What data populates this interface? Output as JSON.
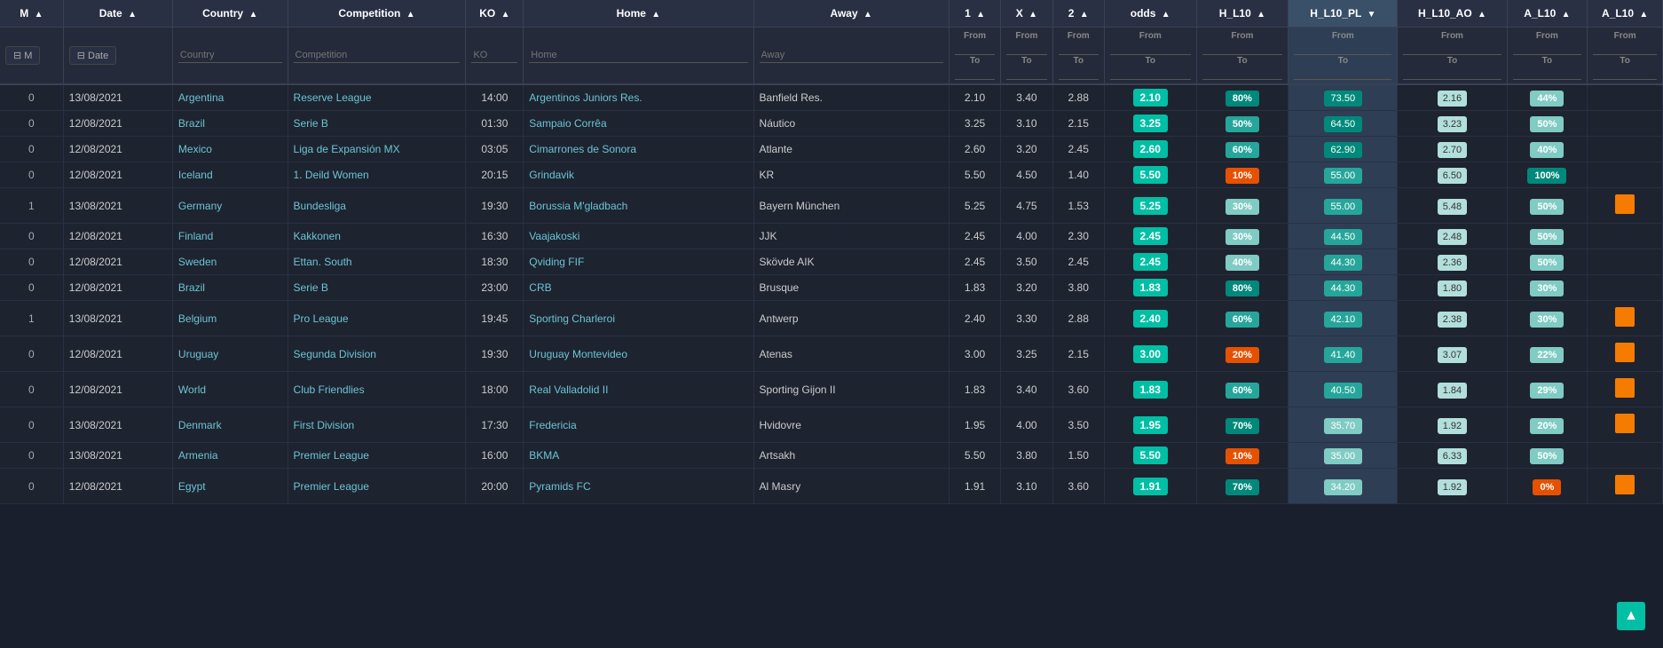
{
  "columns": {
    "m": "M",
    "date": "Date",
    "country": "Country",
    "competition": "Competition",
    "ko": "KO",
    "home": "Home",
    "away": "Away",
    "one": "1",
    "x": "X",
    "two": "2",
    "odds": "odds",
    "h_l10": "H_L10",
    "h_l10_pl": "H_L10_PL",
    "h_l10_ao": "H_L10_AO",
    "a_l10": "A_L10",
    "a_l10_last": "A_L10"
  },
  "filter_row": {
    "m_label": "M",
    "date_label": "Date",
    "country_label": "Country",
    "competition_label": "Competition",
    "ko_label": "KO",
    "home_label": "Home",
    "away_label": "Away",
    "one_label": "1",
    "x_label": "X",
    "two_label": "2",
    "from_label": "From",
    "to_label": "To"
  },
  "rows": [
    {
      "m": "0",
      "date": "13/08/2021",
      "country": "Argentina",
      "competition": "Reserve League",
      "ko": "14:00",
      "home": "Argentinos Juniors Res.",
      "away": "Banfield Res.",
      "one": "2.10",
      "x": "3.40",
      "two": "2.88",
      "odds": "2.10",
      "odds_color": "teal",
      "hl10_pct": "80%",
      "hl10_color": "teal-dark",
      "hl10pl": "73.50",
      "hl10pl_color": "teal-med",
      "hl10ao": "2.16",
      "hl10ao_color": "teal-light",
      "al10_pct": "44%",
      "al10_color": "teal-light",
      "al10_last": ""
    },
    {
      "m": "0",
      "date": "12/08/2021",
      "country": "Brazil",
      "competition": "Serie B",
      "ko": "01:30",
      "home": "Sampaio Corrêa",
      "away": "Náutico",
      "one": "3.25",
      "x": "3.10",
      "two": "2.15",
      "odds": "3.25",
      "odds_color": "teal",
      "hl10_pct": "50%",
      "hl10_color": "teal-med",
      "hl10pl": "64.50",
      "hl10pl_color": "teal-med",
      "hl10ao": "3.23",
      "hl10ao_color": "teal-light",
      "al10_pct": "50%",
      "al10_color": "teal-light",
      "al10_last": ""
    },
    {
      "m": "0",
      "date": "12/08/2021",
      "country": "Mexico",
      "competition": "Liga de Expansión MX",
      "ko": "03:05",
      "home": "Cimarrones de Sonora",
      "away": "Atlante",
      "one": "2.60",
      "x": "3.20",
      "two": "2.45",
      "odds": "2.60",
      "odds_color": "teal",
      "hl10_pct": "60%",
      "hl10_color": "teal-med",
      "hl10pl": "62.90",
      "hl10pl_color": "teal-med",
      "hl10ao": "2.70",
      "hl10ao_color": "teal-light",
      "al10_pct": "40%",
      "al10_color": "teal-light",
      "al10_last": ""
    },
    {
      "m": "0",
      "date": "12/08/2021",
      "country": "Iceland",
      "competition": "1. Deild Women",
      "ko": "20:15",
      "home": "Grindavik",
      "away": "KR",
      "one": "5.50",
      "x": "4.50",
      "two": "1.40",
      "odds": "5.50",
      "odds_color": "teal",
      "hl10_pct": "10%",
      "hl10_color": "orange",
      "hl10pl": "55.00",
      "hl10pl_color": "teal-med",
      "hl10ao": "6.50",
      "hl10ao_color": "teal-dark",
      "al10_pct": "100%",
      "al10_color": "teal-dark",
      "al10_last": ""
    },
    {
      "m": "1",
      "date": "13/08/2021",
      "country": "Germany",
      "competition": "Bundesliga",
      "ko": "19:30",
      "home": "Borussia M'gladbach",
      "away": "Bayern München",
      "one": "5.25",
      "x": "4.75",
      "two": "1.53",
      "odds": "5.25",
      "odds_color": "teal",
      "hl10_pct": "30%",
      "hl10_color": "teal-light",
      "hl10pl": "55.00",
      "hl10pl_color": "teal-med",
      "hl10ao": "5.48",
      "hl10ao_color": "teal-light",
      "al10_pct": "50%",
      "al10_color": "teal-light",
      "al10_last": "orange"
    },
    {
      "m": "0",
      "date": "12/08/2021",
      "country": "Finland",
      "competition": "Kakkonen",
      "ko": "16:30",
      "home": "Vaajakoski",
      "away": "JJK",
      "one": "2.45",
      "x": "4.00",
      "two": "2.30",
      "odds": "2.45",
      "odds_color": "teal",
      "hl10_pct": "30%",
      "hl10_color": "teal-light",
      "hl10pl": "44.50",
      "hl10pl_color": "teal-med",
      "hl10ao": "2.48",
      "hl10ao_color": "teal-light",
      "al10_pct": "50%",
      "al10_color": "teal-light",
      "al10_last": ""
    },
    {
      "m": "0",
      "date": "12/08/2021",
      "country": "Sweden",
      "competition": "Ettan. South",
      "ko": "18:30",
      "home": "Qviding FIF",
      "away": "Skövde AIK",
      "one": "2.45",
      "x": "3.50",
      "two": "2.45",
      "odds": "2.45",
      "odds_color": "teal",
      "hl10_pct": "40%",
      "hl10_color": "teal-light",
      "hl10pl": "44.30",
      "hl10pl_color": "teal-med",
      "hl10ao": "2.36",
      "hl10ao_color": "teal-light",
      "al10_pct": "50%",
      "al10_color": "teal-light",
      "al10_last": ""
    },
    {
      "m": "0",
      "date": "12/08/2021",
      "country": "Brazil",
      "competition": "Serie B",
      "ko": "23:00",
      "home": "CRB",
      "away": "Brusque",
      "one": "1.83",
      "x": "3.20",
      "two": "3.80",
      "odds": "1.83",
      "odds_color": "teal",
      "hl10_pct": "80%",
      "hl10_color": "teal-dark",
      "hl10pl": "44.30",
      "hl10pl_color": "teal-med",
      "hl10ao": "1.80",
      "hl10ao_color": "teal-light",
      "al10_pct": "30%",
      "al10_color": "teal-light",
      "al10_last": ""
    },
    {
      "m": "1",
      "date": "13/08/2021",
      "country": "Belgium",
      "competition": "Pro League",
      "ko": "19:45",
      "home": "Sporting Charleroi",
      "away": "Antwerp",
      "one": "2.40",
      "x": "3.30",
      "two": "2.88",
      "odds": "2.40",
      "odds_color": "teal",
      "hl10_pct": "60%",
      "hl10_color": "teal-med",
      "hl10pl": "42.10",
      "hl10pl_color": "teal-med",
      "hl10ao": "2.38",
      "hl10ao_color": "teal-light",
      "al10_pct": "30%",
      "al10_color": "teal-light",
      "al10_last": "orange"
    },
    {
      "m": "0",
      "date": "12/08/2021",
      "country": "Uruguay",
      "competition": "Segunda Division",
      "ko": "19:30",
      "home": "Uruguay Montevideo",
      "away": "Atenas",
      "one": "3.00",
      "x": "3.25",
      "two": "2.15",
      "odds": "3.00",
      "odds_color": "teal",
      "hl10_pct": "20%",
      "hl10_color": "orange",
      "hl10pl": "41.40",
      "hl10pl_color": "teal-med",
      "hl10ao": "3.07",
      "hl10ao_color": "teal-light",
      "al10_pct": "22%",
      "al10_color": "teal-light",
      "al10_last": "orange"
    },
    {
      "m": "0",
      "date": "12/08/2021",
      "country": "World",
      "competition": "Club Friendlies",
      "ko": "18:00",
      "home": "Real Valladolid II",
      "away": "Sporting Gijon II",
      "one": "1.83",
      "x": "3.40",
      "two": "3.60",
      "odds": "1.83",
      "odds_color": "teal",
      "hl10_pct": "60%",
      "hl10_color": "teal-med",
      "hl10pl": "40.50",
      "hl10pl_color": "teal-med",
      "hl10ao": "1.84",
      "hl10ao_color": "teal-light",
      "al10_pct": "29%",
      "al10_color": "teal-light",
      "al10_last": "orange"
    },
    {
      "m": "0",
      "date": "13/08/2021",
      "country": "Denmark",
      "competition": "First Division",
      "ko": "17:30",
      "home": "Fredericia",
      "away": "Hvidovre",
      "one": "1.95",
      "x": "4.00",
      "two": "3.50",
      "odds": "1.95",
      "odds_color": "teal",
      "hl10_pct": "70%",
      "hl10_color": "teal-dark",
      "hl10pl": "35.70",
      "hl10pl_color": "teal-light",
      "hl10ao": "1.92",
      "hl10ao_color": "teal-light",
      "al10_pct": "20%",
      "al10_color": "teal-light",
      "al10_last": "orange"
    },
    {
      "m": "0",
      "date": "13/08/2021",
      "country": "Armenia",
      "competition": "Premier League",
      "ko": "16:00",
      "home": "BKMA",
      "away": "Artsakh",
      "one": "5.50",
      "x": "3.80",
      "two": "1.50",
      "odds": "5.50",
      "odds_color": "teal",
      "hl10_pct": "10%",
      "hl10_color": "orange",
      "hl10pl": "35.00",
      "hl10pl_color": "teal-light",
      "hl10ao": "6.33",
      "hl10ao_color": "teal-light",
      "al10_pct": "50%",
      "al10_color": "teal-light",
      "al10_last": ""
    },
    {
      "m": "0",
      "date": "12/08/2021",
      "country": "Egypt",
      "competition": "Premier League",
      "ko": "20:00",
      "home": "Pyramids FC",
      "away": "Al Masry",
      "one": "1.91",
      "x": "3.10",
      "two": "3.60",
      "odds": "1.91",
      "odds_color": "teal",
      "hl10_pct": "70%",
      "hl10_color": "teal-dark",
      "hl10pl": "34.20",
      "hl10pl_color": "teal-light",
      "hl10ao": "1.92",
      "hl10ao_color": "teal-light",
      "al10_pct": "0%",
      "al10_color": "orange",
      "al10_last": "orange"
    }
  ],
  "scroll_top": "▲"
}
